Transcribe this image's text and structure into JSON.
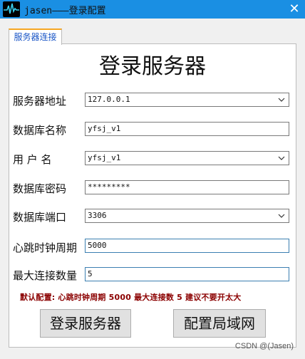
{
  "window": {
    "title": "jasen———登录配置",
    "close_glyph": "✕"
  },
  "tab": {
    "label": "服务器连接"
  },
  "main": {
    "heading": "登录服务器",
    "server_label": "服务器地址",
    "server_value": "127.0.0.1",
    "dbname_label": "数据库名称",
    "dbname_value": "yfsj_v1",
    "user_label": "用 户 名",
    "user_value": "yfsj_v1",
    "password_label": "数据库密码",
    "password_value": "*********",
    "port_label": "数据库端口",
    "port_value": "3306",
    "heartbeat_label": "心跳时钟周期",
    "heartbeat_value": "5000",
    "maxconn_label": "最大连接数量",
    "maxconn_value": "5",
    "note": "默认配置: 心跳时钟周期  5000   最大连接数  5  建议不要开太大",
    "login_button": "登录服务器",
    "lan_button": "配置局域网"
  },
  "watermark": "CSDN @(Jasen)",
  "colors": {
    "titlebar": "#1a8fe3",
    "note": "#8b0000",
    "tab_accent": "#f6a623"
  }
}
